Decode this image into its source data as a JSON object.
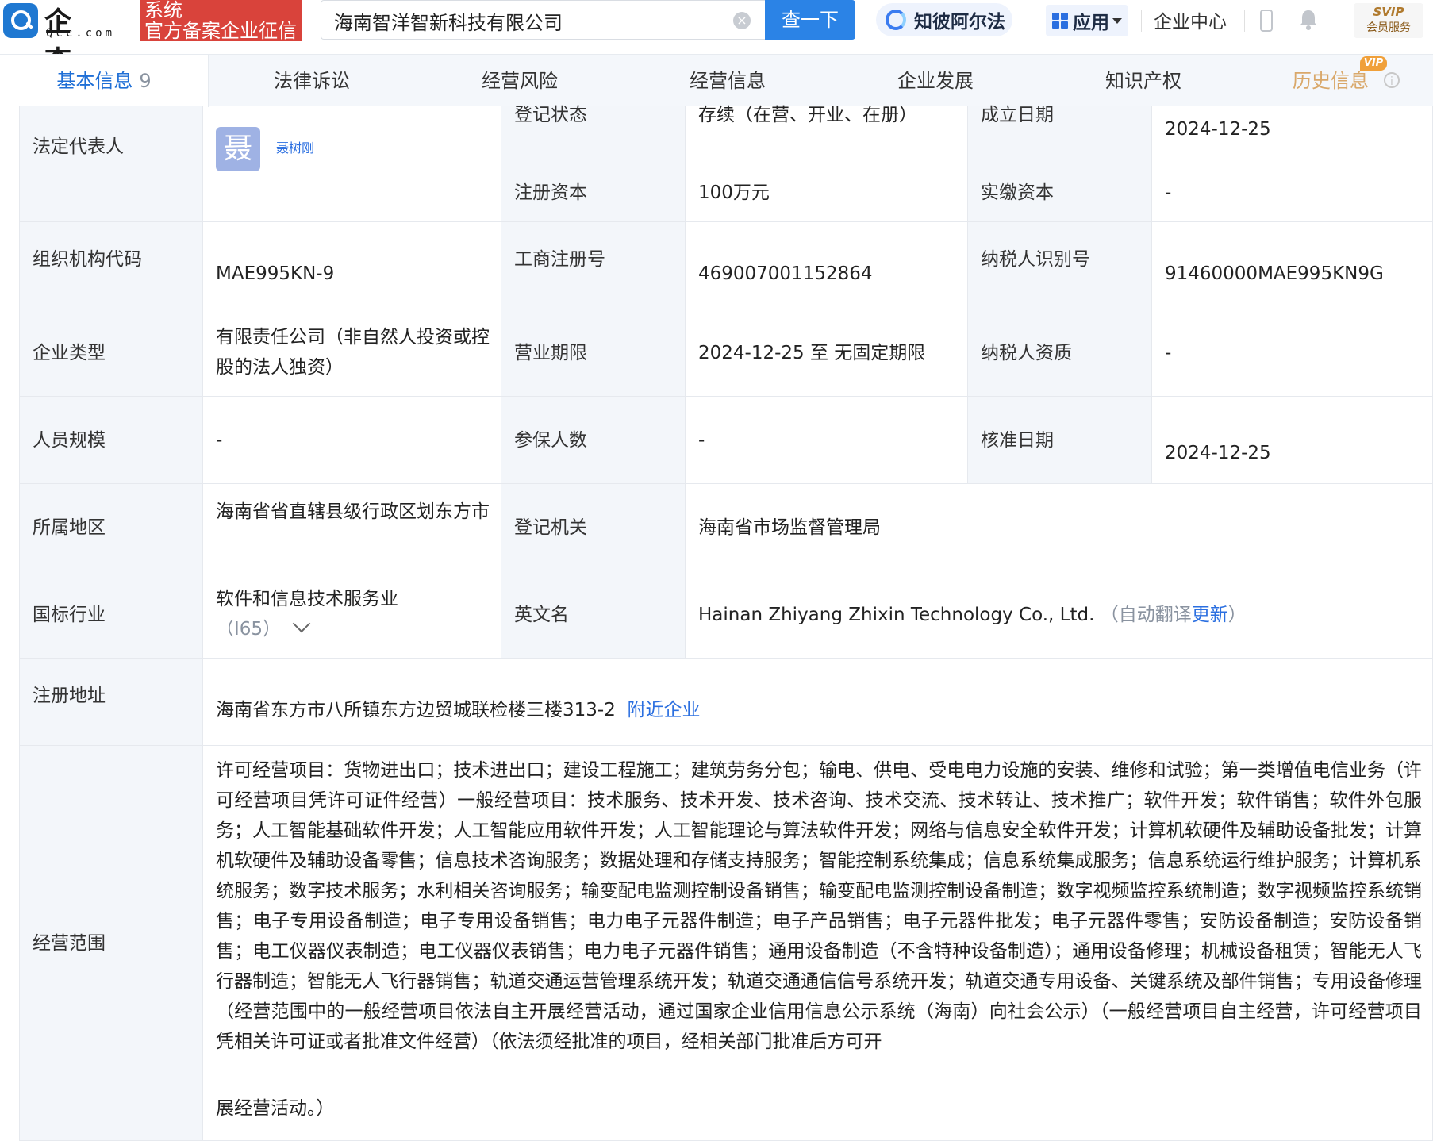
{
  "header": {
    "logo_text": "企查查",
    "logo_sub": "Qcc.com",
    "logo_badge_line1": "系统",
    "logo_badge_line2": "官方备案企业征信",
    "search_value": "海南智洋智新科技有限公司",
    "search_button": "查一下",
    "ai_label": "知彼阿尔法",
    "app_label": "应用",
    "center_label": "企业中心",
    "svip_top": "SVIP",
    "svip_bottom": "会员服务"
  },
  "tabs": [
    {
      "label": "基本信息",
      "count": "9"
    },
    {
      "label": "法律诉讼"
    },
    {
      "label": "经营风险"
    },
    {
      "label": "经营信息"
    },
    {
      "label": "企业发展"
    },
    {
      "label": "知识产权"
    },
    {
      "label": "历史信息",
      "vip": "VIP"
    }
  ],
  "info": {
    "legal_rep_label": "法定代表人",
    "legal_rep_avatar": "聂",
    "legal_rep_name": "聂树刚",
    "reg_status_label": "登记状态",
    "reg_status_value": "存续（在营、开业、在册）",
    "found_date_label": "成立日期",
    "found_date_value": "2024-12-25",
    "reg_capital_label": "注册资本",
    "reg_capital_value": "100万元",
    "paid_capital_label": "实缴资本",
    "paid_capital_value": "-",
    "org_code_label": "组织机构代码",
    "org_code_value": "MAE995KN-9",
    "biz_reg_no_label": "工商注册号",
    "biz_reg_no_value": "469007001152864",
    "taxpayer_id_label": "纳税人识别号",
    "taxpayer_id_value": "91460000MAE995KN9G",
    "company_type_label": "企业类型",
    "company_type_value": "有限责任公司（非自然人投资或控股的法人独资）",
    "biz_term_label": "营业期限",
    "biz_term_value": "2024-12-25 至 无固定期限",
    "taxpayer_qual_label": "纳税人资质",
    "taxpayer_qual_value": "-",
    "staff_size_label": "人员规模",
    "staff_size_value": "-",
    "insured_label": "参保人数",
    "insured_value": "-",
    "approval_date_label": "核准日期",
    "approval_date_value": "2024-12-25",
    "region_label": "所属地区",
    "region_value": "海南省省直辖县级行政区划东方市",
    "reg_authority_label": "登记机关",
    "reg_authority_value": "海南省市场监督管理局",
    "industry_label": "国标行业",
    "industry_value": "软件和信息技术服务业",
    "industry_code": "（I65）",
    "english_name_label": "英文名",
    "english_name_value": "Hainan Zhiyang Zhixin Technology Co., Ltd.",
    "english_auto_prefix": "（自动翻译",
    "english_update": "更新",
    "english_auto_suffix": "）",
    "reg_address_label": "注册地址",
    "reg_address_value": "海南省东方市八所镇东方边贸城联检楼三楼313-2",
    "nearby_link": "附近企业",
    "scope_label": "经营范围",
    "scope_value": "许可经营项目：货物进出口；技术进出口；建设工程施工；建筑劳务分包；输电、供电、受电电力设施的安装、维修和试验；第一类增值电信业务（许可经营项目凭许可证件经营）一般经营项目：技术服务、技术开发、技术咨询、技术交流、技术转让、技术推广；软件开发；软件销售；软件外包服务；人工智能基础软件开发；人工智能应用软件开发；人工智能理论与算法软件开发；网络与信息安全软件开发；计算机软硬件及辅助设备批发；计算机软硬件及辅助设备零售；信息技术咨询服务；数据处理和存储支持服务；智能控制系统集成；信息系统集成服务；信息系统运行维护服务；计算机系统服务；数字技术服务；水利相关咨询服务；输变配电监测控制设备销售；输变配电监测控制设备制造；数字视频监控系统制造；数字视频监控系统销售；电子专用设备制造；电子专用设备销售；电力电子元器件制造；电子产品销售；电子元器件批发；电子元器件零售；安防设备制造；安防设备销售；电工仪器仪表制造；电工仪器仪表销售；电力电子元器件销售；通用设备制造（不含特种设备制造）；通用设备修理；机械设备租赁；智能无人飞行器制造；智能无人飞行器销售；轨道交通运营管理系统开发；轨道交通通信信号系统开发；轨道交通专用设备、关键系统及部件销售；专用设备修理（经营范围中的一般经营项目依法自主开展经营活动，通过国家企业信用信息公示系统（海南）向社会公示）（一般经营项目自主经营，许可经营项目凭相关许可证或者批准文件经营）（依法须经批准的项目，经相关部门批准后方可开",
    "scope_tail": "展经营活动。）"
  }
}
